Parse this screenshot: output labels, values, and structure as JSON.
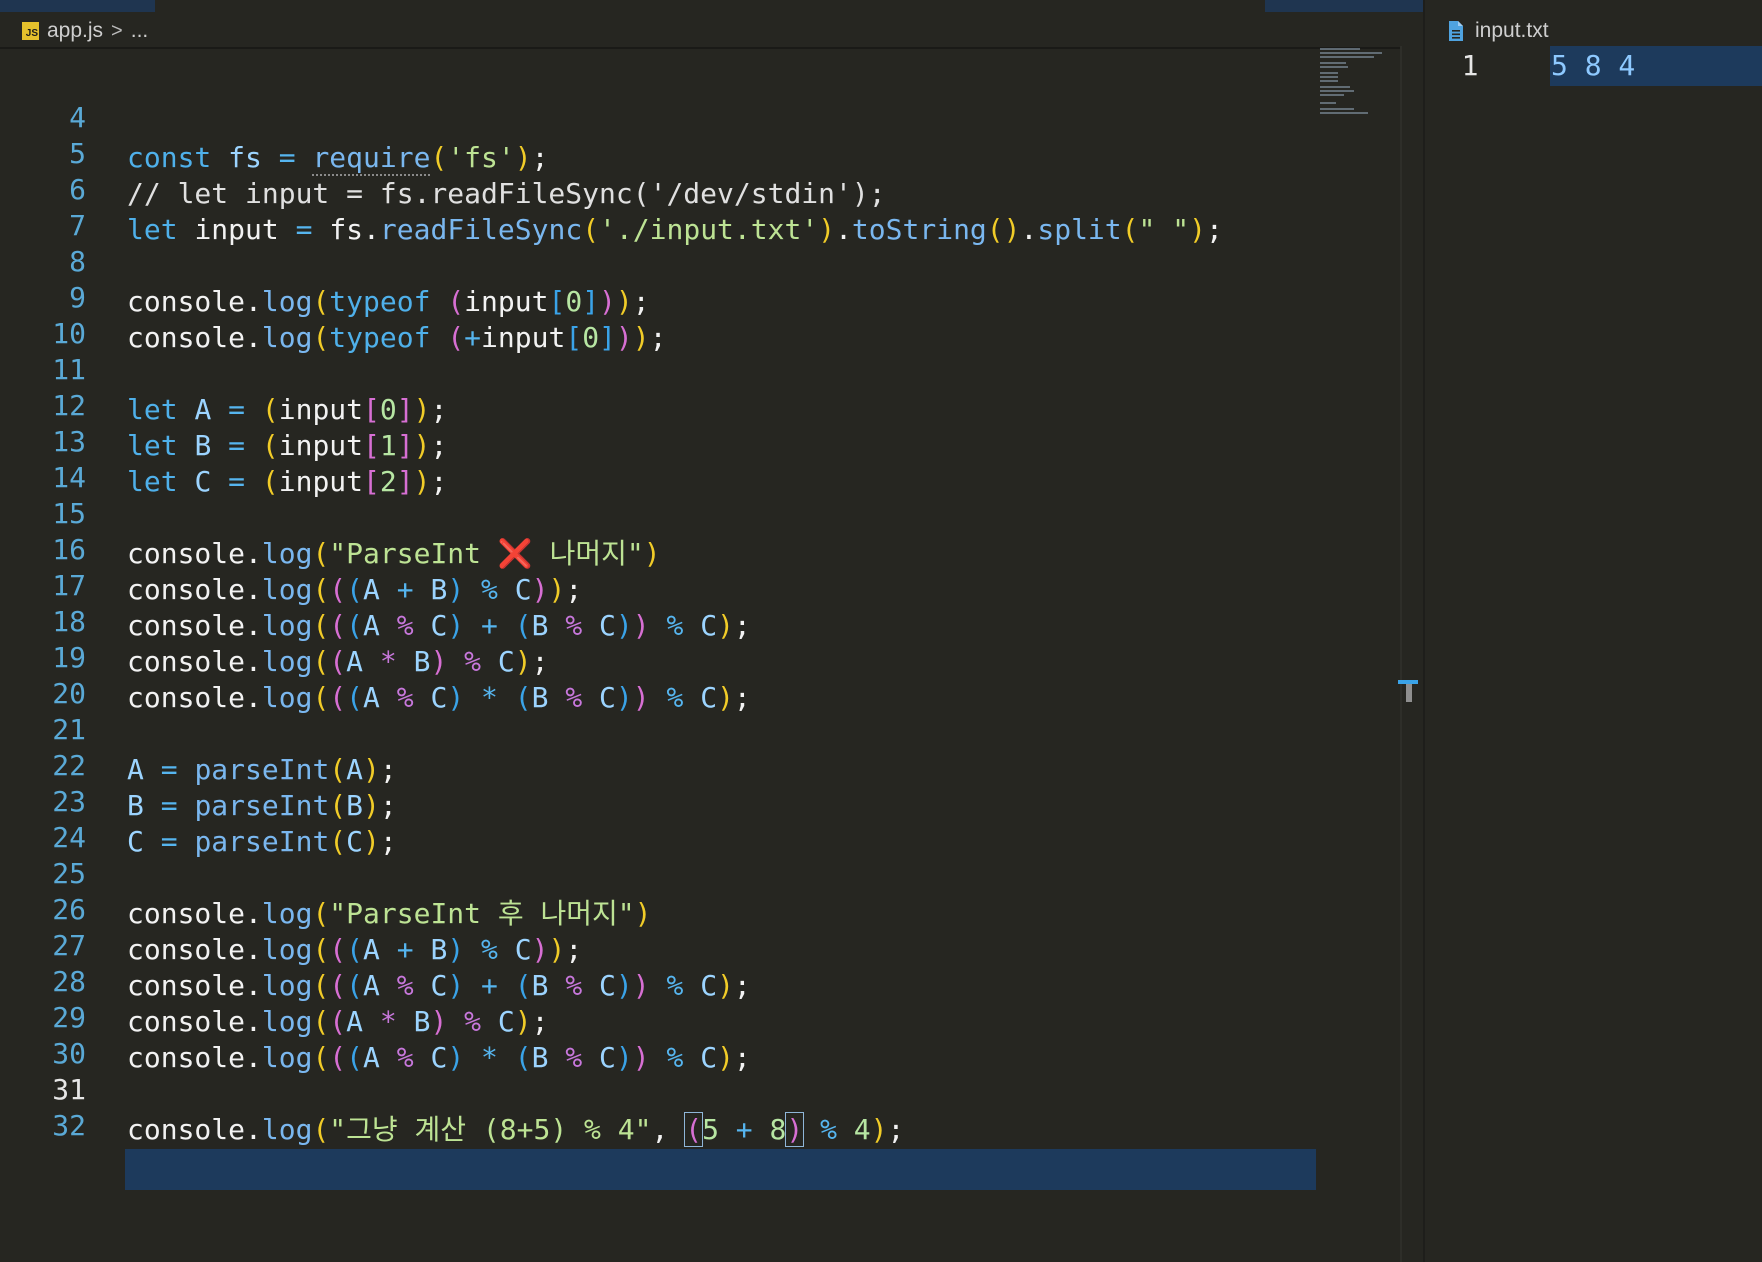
{
  "left_tab": {
    "file_name": "app.js",
    "badge": "JS",
    "breadcrumb_sep": ">",
    "breadcrumb_more": "..."
  },
  "right_tab": {
    "file_name": "input.txt"
  },
  "input_file": {
    "line_number": "1",
    "content": "5 8 4"
  },
  "current_line": "31",
  "code_lines": [
    {
      "n": "4",
      "text": "const fs = require('fs');"
    },
    {
      "n": "5",
      "text": "// let input = fs.readFileSync('/dev/stdin');"
    },
    {
      "n": "6",
      "text": "let input = fs.readFileSync('./input.txt').toString().split(\" \");"
    },
    {
      "n": "7",
      "text": ""
    },
    {
      "n": "8",
      "text": "console.log(typeof (input[0]));"
    },
    {
      "n": "9",
      "text": "console.log(typeof (+input[0]));"
    },
    {
      "n": "10",
      "text": ""
    },
    {
      "n": "11",
      "text": "let A = (input[0]);"
    },
    {
      "n": "12",
      "text": "let B = (input[1]);"
    },
    {
      "n": "13",
      "text": "let C = (input[2]);"
    },
    {
      "n": "14",
      "text": ""
    },
    {
      "n": "15",
      "text": "console.log(\"ParseInt ❌ 나머지\")"
    },
    {
      "n": "16",
      "text": "console.log(((A + B) % C));"
    },
    {
      "n": "17",
      "text": "console.log(((A % C) + (B % C)) % C);"
    },
    {
      "n": "18",
      "text": "console.log((A * B) % C);"
    },
    {
      "n": "19",
      "text": "console.log(((A % C) * (B % C)) % C);"
    },
    {
      "n": "20",
      "text": ""
    },
    {
      "n": "21",
      "text": "A = parseInt(A);"
    },
    {
      "n": "22",
      "text": "B = parseInt(B);"
    },
    {
      "n": "23",
      "text": "C = parseInt(C);"
    },
    {
      "n": "24",
      "text": ""
    },
    {
      "n": "25",
      "text": "console.log(\"ParseInt 후 나머지\")"
    },
    {
      "n": "26",
      "text": "console.log(((A + B) % C));"
    },
    {
      "n": "27",
      "text": "console.log(((A % C) + (B % C)) % C);"
    },
    {
      "n": "28",
      "text": "console.log((A * B) % C);"
    },
    {
      "n": "29",
      "text": "console.log(((A % C) * (B % C)) % C);"
    },
    {
      "n": "30",
      "text": ""
    },
    {
      "n": "31",
      "text": "console.log(\"그냥 계산 (8+5) % 4\", (5 + 8) % 4);"
    },
    {
      "n": "32",
      "text": ""
    }
  ],
  "colors": {
    "background": "#262621",
    "line_number": "#5aa9d6",
    "current_line_highlight": "#1d3a5c",
    "keyword": "#4fb0ea",
    "string": "#bde394",
    "bracket_gold": "#f1cc28",
    "bracket_pink": "#d76fd3",
    "bracket_blue": "#3aa3e8"
  }
}
